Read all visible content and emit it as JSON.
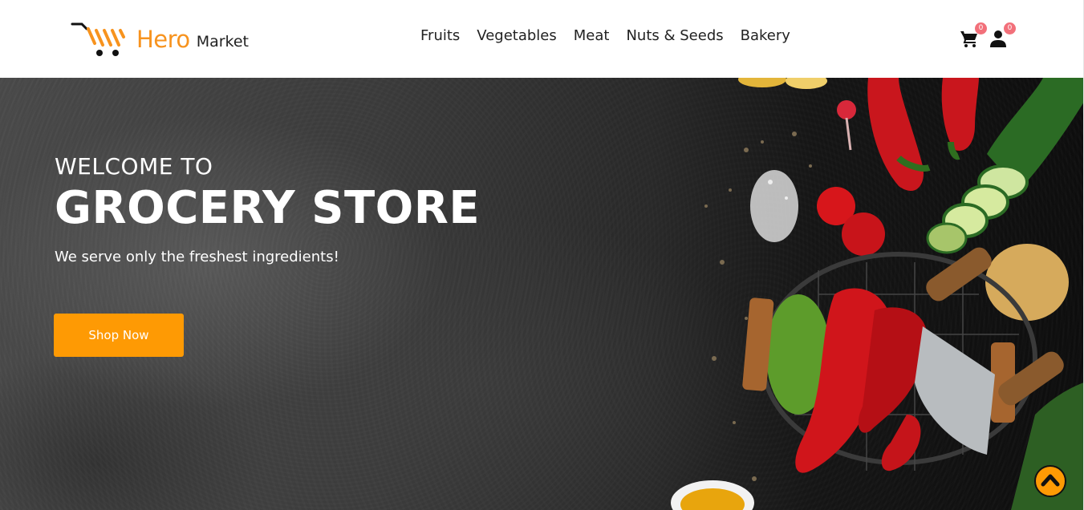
{
  "header": {
    "logo": {
      "hero": "Hero",
      "market": "Market",
      "icon": "shopping-cart-logo-icon"
    },
    "nav": [
      {
        "label": "Fruits"
      },
      {
        "label": "Vegetables"
      },
      {
        "label": "Meat"
      },
      {
        "label": "Nuts & Seeds"
      },
      {
        "label": "Bakery"
      }
    ],
    "cart": {
      "icon": "cart-icon",
      "count": "0"
    },
    "user": {
      "icon": "user-icon",
      "count": "0"
    }
  },
  "hero": {
    "welcome": "WELCOME TO",
    "title": "GROCERY STORE",
    "subtitle": "We serve only the freshest ingredients!",
    "cta": "Shop Now"
  },
  "scroll_top": {
    "icon": "chevron-up-icon"
  },
  "colors": {
    "accent": "#fe9a04",
    "brand": "#f7931e",
    "badge": "#f2707a",
    "text": "#222222"
  }
}
